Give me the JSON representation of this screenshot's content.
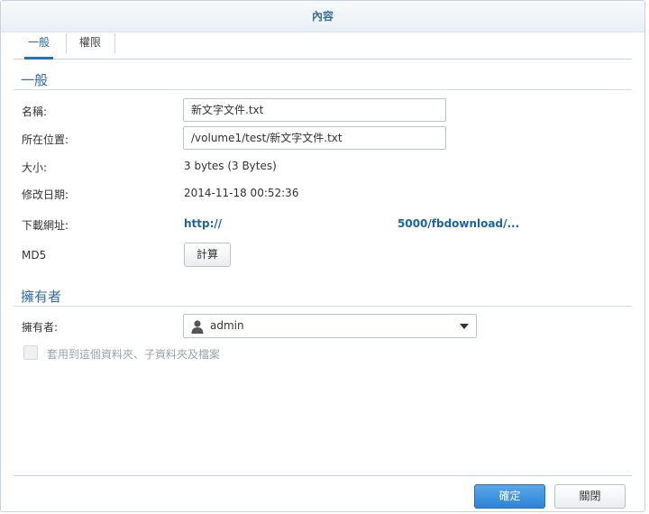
{
  "dialog": {
    "title": "內容",
    "tabs": [
      {
        "label": "一般",
        "active": true
      },
      {
        "label": "權限",
        "active": false
      }
    ],
    "general": {
      "section_title": "一般",
      "name_label": "名稱:",
      "name_value": "新文字文件.txt",
      "location_label": "所在位置:",
      "location_value": "/volume1/test/新文字文件.txt",
      "size_label": "大小:",
      "size_value": "3 bytes (3 Bytes)",
      "modified_label": "修改日期:",
      "modified_value": "2014-11-18 00:52:36",
      "download_label": "下載網址:",
      "download_link_part1": "http://",
      "download_link_part2": "5000/fbdownload/...",
      "md5_label": "MD5",
      "compute_button": "計算"
    },
    "owner": {
      "section_title": "擁有者",
      "owner_label": "擁有者:",
      "owner_value": "admin",
      "apply_checkbox_label": "套用到這個資料夾、子資料夾及檔案",
      "apply_checked": false
    },
    "footer": {
      "ok_button": "確定",
      "close_button": "關閉"
    },
    "colors": {
      "accent": "#2f6eaa",
      "link": "#1b64a5",
      "primary_button": "#2d83d6"
    }
  }
}
